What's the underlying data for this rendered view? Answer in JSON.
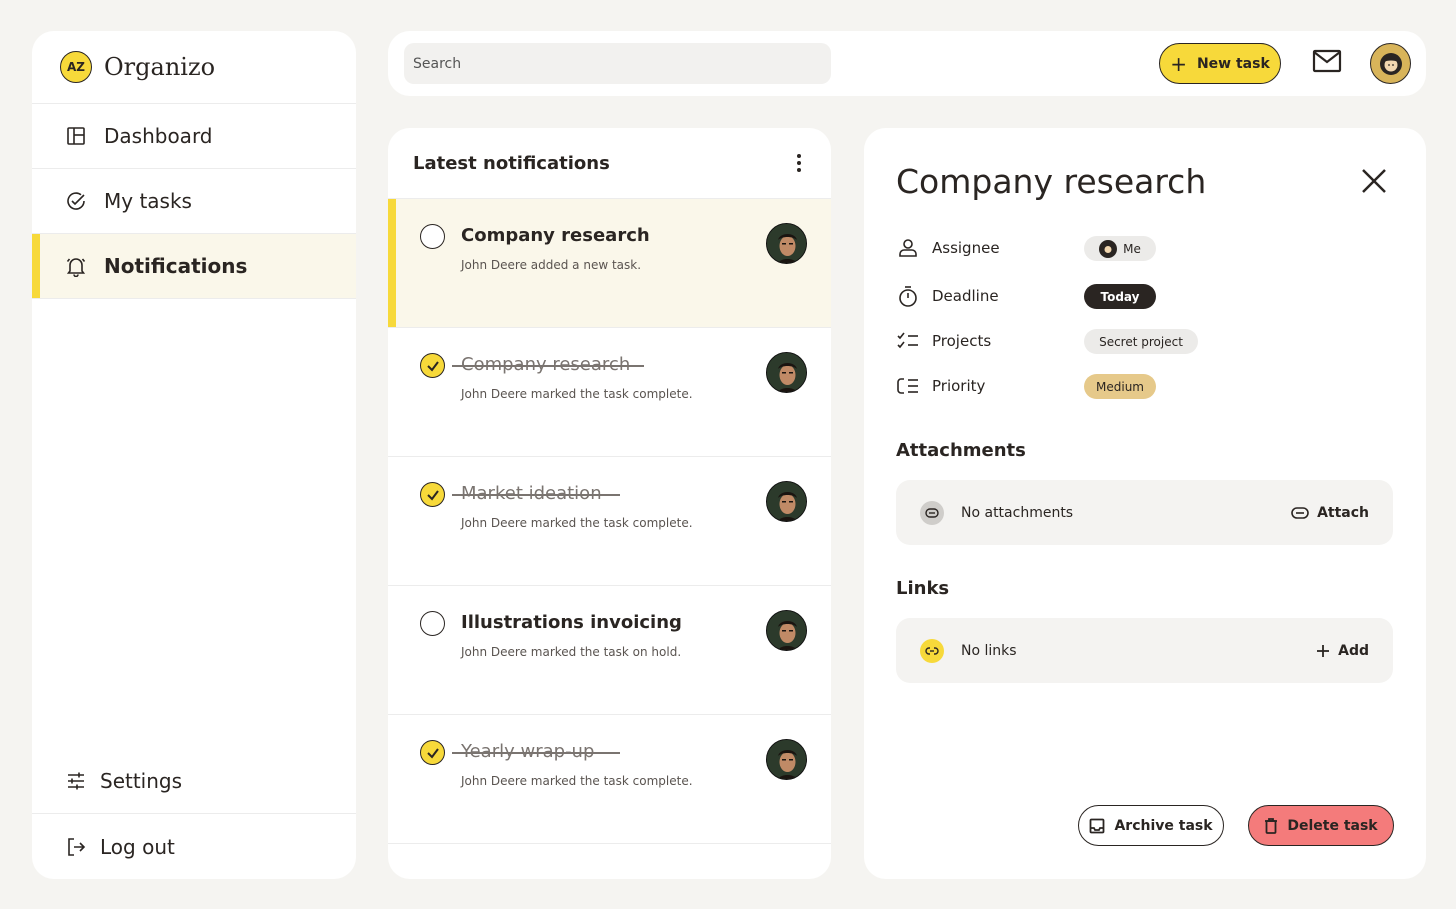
{
  "app": {
    "name": "Organizo",
    "logo_text": "AZ"
  },
  "sidebar": {
    "items": [
      {
        "label": "Dashboard",
        "icon": "layout-icon"
      },
      {
        "label": "My tasks",
        "icon": "check-circle-icon"
      },
      {
        "label": "Notifications",
        "icon": "bell-icon",
        "active": true
      }
    ],
    "bottom": [
      {
        "label": "Settings",
        "icon": "sliders-icon"
      },
      {
        "label": "Log out",
        "icon": "logout-icon"
      }
    ]
  },
  "topbar": {
    "search_placeholder": "Search",
    "new_task_label": "New task"
  },
  "notifications": {
    "title": "Latest notifications",
    "items": [
      {
        "task": "Company research",
        "desc": "John Deere added a new task.",
        "done": false,
        "selected": true
      },
      {
        "task": "Company research",
        "desc": "John Deere marked the task complete.",
        "done": true
      },
      {
        "task": "Market ideation",
        "desc": "John Deere marked the task complete.",
        "done": true
      },
      {
        "task": "Illustrations invoicing",
        "desc": "John Deere marked the task on hold.",
        "done": false
      },
      {
        "task": "Yearly wrap-up",
        "desc": "John Deere marked the task complete.",
        "done": true
      }
    ]
  },
  "detail": {
    "title": "Company research",
    "props": {
      "assignee_label": "Assignee",
      "assignee_value": "Me",
      "deadline_label": "Deadline",
      "deadline_value": "Today",
      "projects_label": "Projects",
      "projects_value": "Secret project",
      "priority_label": "Priority",
      "priority_value": "Medium"
    },
    "attachments": {
      "title": "Attachments",
      "empty_text": "No attachments",
      "action_label": "Attach"
    },
    "links": {
      "title": "Links",
      "empty_text": "No links",
      "action_label": "Add"
    },
    "archive_label": "Archive task",
    "delete_label": "Delete task"
  },
  "colors": {
    "accent": "#f7d93a",
    "dark": "#2a2522",
    "danger": "#f47b7b",
    "priority_medium": "#e6c98a"
  }
}
